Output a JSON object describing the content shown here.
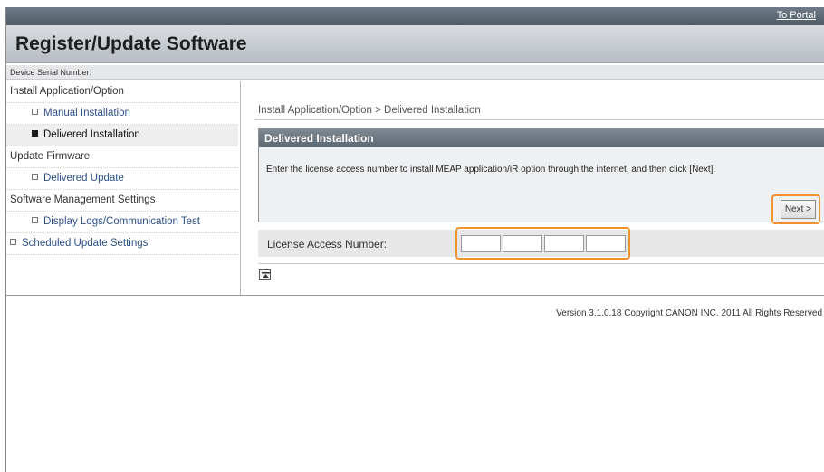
{
  "header": {
    "portal_link": "To Portal",
    "title": "Register/Update Software",
    "serial_label": "Device Serial Number:"
  },
  "sidebar": {
    "items": [
      {
        "label": "Install Application/Option",
        "kind": "section"
      },
      {
        "label": "Manual Installation",
        "kind": "sub"
      },
      {
        "label": "Delivered Installation",
        "kind": "sub-active"
      },
      {
        "label": "Update Firmware",
        "kind": "section"
      },
      {
        "label": "Delivered Update",
        "kind": "sub"
      },
      {
        "label": "Software Management Settings",
        "kind": "section"
      },
      {
        "label": "Display Logs/Communication Test",
        "kind": "sub"
      },
      {
        "label": "Scheduled Update Settings",
        "kind": "section-link"
      }
    ]
  },
  "main": {
    "breadcrumb": "Install Application/Option > Delivered Installation",
    "panel_title": "Delivered Installation",
    "instruction": "Enter the license access number to install MEAP application/iR option through the internet, and then click [Next].",
    "next_label": "Next >",
    "license_label": "License Access Number:",
    "license_fields": [
      "",
      "",
      "",
      ""
    ]
  },
  "footer": {
    "version": "Version 3.1.0.18 Copyright CANON INC. 2011 All Rights Reserved"
  },
  "icons": {
    "to_top": "to-top-icon",
    "bullet": "square-bullet-icon"
  },
  "colors": {
    "highlight": "#f0922d",
    "panel_header": "#6b7680",
    "link": "#2c4f86"
  }
}
